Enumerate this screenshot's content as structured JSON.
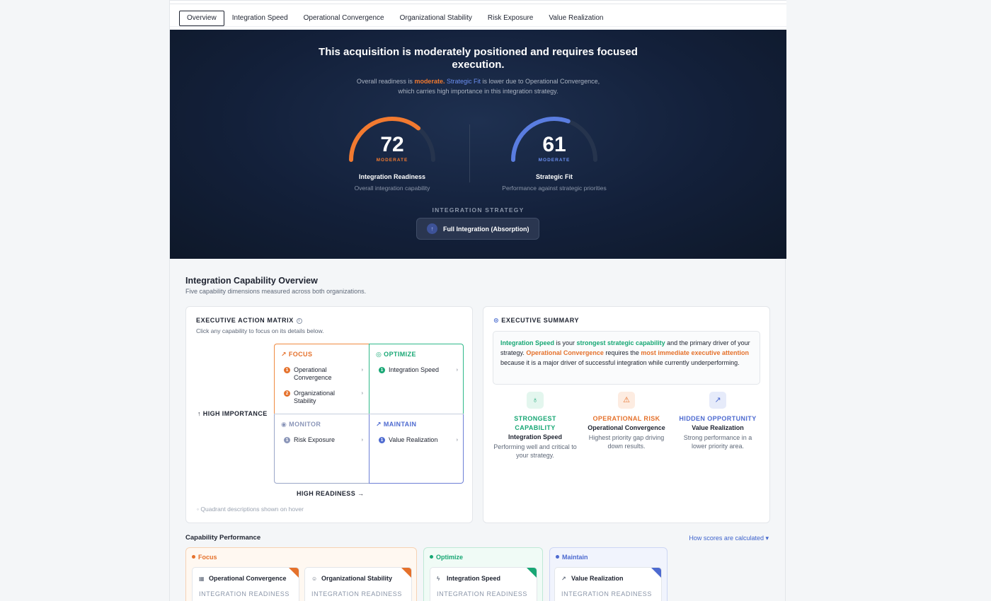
{
  "tabs": [
    "Overview",
    "Integration Speed",
    "Operational Convergence",
    "Organizational Stability",
    "Risk Exposure",
    "Value Realization"
  ],
  "hero": {
    "headline": "This acquisition is moderately positioned and requires focused execution.",
    "sub_prefix": "Overall readiness is ",
    "sub_moderate": "moderate.",
    "sub_fit": "Strategic Fit",
    "sub_suffix": " is lower due to Operational Convergence, which carries high importance in this integration strategy.",
    "gauges": [
      {
        "value": "72",
        "fraction": 0.72,
        "level": "MODERATE",
        "label": "Integration Readiness",
        "desc": "Overall integration capability",
        "color": "#f27a30"
      },
      {
        "value": "61",
        "fraction": 0.61,
        "level": "MODERATE",
        "label": "Strategic Fit",
        "desc": "Performance against strategic priorities",
        "color": "#5a7de0"
      }
    ],
    "strategy_title": "INTEGRATION STRATEGY",
    "strategy_value": "Full Integration (Absorption)"
  },
  "section": {
    "title": "Integration Capability Overview",
    "subtitle": "Five capability dimensions measured across both organizations."
  },
  "matrix": {
    "title": "EXECUTIVE ACTION MATRIX",
    "subtitle": "Click any capability to focus on its details below.",
    "y_label": "↑ HIGH IMPORTANCE",
    "x_label": "HIGH READINESS →",
    "footnote": "◦ Quadrant descriptions shown on hover",
    "quadrants": {
      "focus": {
        "label": "FOCUS",
        "icon": "↗",
        "items": [
          "Operational Convergence",
          "Organizational Stability"
        ]
      },
      "optimize": {
        "label": "OPTIMIZE",
        "icon": "◎",
        "items": [
          "Integration Speed"
        ]
      },
      "monitor": {
        "label": "MONITOR",
        "icon": "◉",
        "items": [
          "Risk Exposure"
        ]
      },
      "maintain": {
        "label": "MAINTAIN",
        "icon": "↗",
        "items": [
          "Value Realization"
        ]
      }
    }
  },
  "summary": {
    "title": "EXECUTIVE SUMMARY",
    "s1": "Integration Speed",
    "s2": " is your ",
    "s3": "strongest strategic capability",
    "s4": " and the primary driver of your strategy. ",
    "s5": "Operational Convergence",
    "s6": " requires the ",
    "s7": "most immediate executive attention",
    "s8": " because it is a major driver of successful integration while currently underperforming.",
    "columns": [
      {
        "title": "STRONGEST CAPABILITY",
        "name": "Integration Speed",
        "desc": "Performing well and critical to your strategy.",
        "color": "#17a774",
        "bg": "#e3f6ee",
        "icon": "♁"
      },
      {
        "title": "OPERATIONAL RISK",
        "name": "Operational Convergence",
        "desc": "Highest priority gap driving down results.",
        "color": "#e5712b",
        "bg": "#fdece1",
        "icon": "⚠"
      },
      {
        "title": "HIDDEN OPPORTUNITY",
        "name": "Value Realization",
        "desc": "Strong performance in a lower priority area.",
        "color": "#4d6ad0",
        "bg": "#e6ebfa",
        "icon": "↗"
      }
    ]
  },
  "performance": {
    "title": "Capability Performance",
    "link": "How scores are calculated ▾",
    "groups": [
      {
        "label": "Focus",
        "color": "#e5712b",
        "cards": [
          {
            "name": "Operational Convergence",
            "metric": "INTEGRATION READINESS",
            "icon": "▦"
          },
          {
            "name": "Organizational Stability",
            "metric": "INTEGRATION READINESS",
            "icon": "☺"
          }
        ]
      },
      {
        "label": "Optimize",
        "color": "#17a774",
        "cards": [
          {
            "name": "Integration Speed",
            "metric": "INTEGRATION READINESS",
            "icon": "ϟ"
          }
        ]
      },
      {
        "label": "Maintain",
        "color": "#4d6ad0",
        "cards": [
          {
            "name": "Value Realization",
            "metric": "INTEGRATION READINESS",
            "icon": "↗"
          }
        ]
      }
    ]
  }
}
